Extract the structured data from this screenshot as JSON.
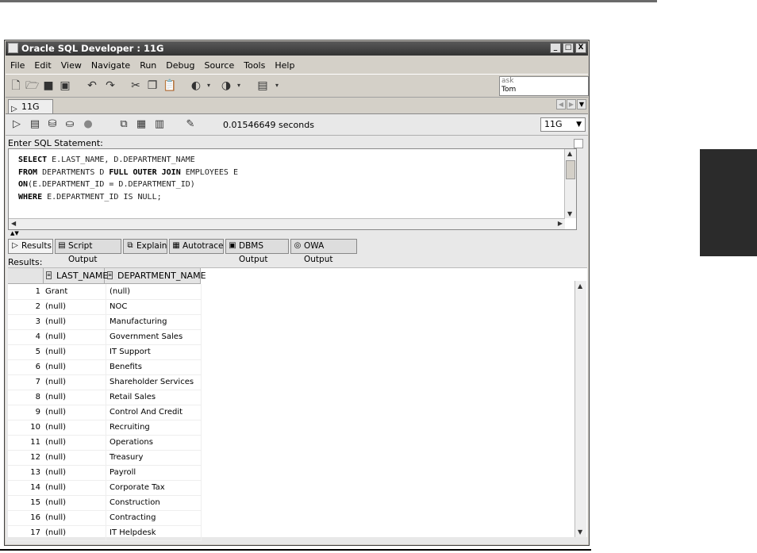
{
  "window": {
    "title": "Oracle SQL Developer : 11G",
    "buttons": [
      "_",
      "□",
      "X"
    ]
  },
  "menu": [
    "File",
    "Edit",
    "View",
    "Navigate",
    "Run",
    "Debug",
    "Source",
    "Tools",
    "Help"
  ],
  "toolbar": {
    "ask_label": "ask",
    "ask_user": "Tom"
  },
  "doc_tab": {
    "label": "11G"
  },
  "worksheet": {
    "timing": "0.01546649 seconds",
    "connection": "11G",
    "sql_label": "Enter SQL Statement:",
    "sql_lines": [
      {
        "kw1": "SELECT",
        "rest1": " E.LAST_NAME, D.DEPARTMENT_NAME"
      },
      {
        "kw1": "FROM",
        "rest1": " DEPARTMENTS D ",
        "kw2": "FULL OUTER JOIN",
        "rest2": " EMPLOYEES E"
      },
      {
        "kw1": "ON",
        "rest1": "(E.DEPARTMENT_ID = D.DEPARTMENT_ID)"
      },
      {
        "kw1": "WHERE",
        "rest1": " E.DEPARTMENT_ID IS NULL;"
      }
    ]
  },
  "result_tabs": [
    "Results",
    "Script Output",
    "Explain",
    "Autotrace",
    "DBMS Output",
    "OWA Output"
  ],
  "results_label": "Results:",
  "grid": {
    "columns": [
      "LAST_NAME",
      "DEPARTMENT_NAME"
    ],
    "rows": [
      {
        "n": "1",
        "last": "Grant",
        "dept": "(null)"
      },
      {
        "n": "2",
        "last": "(null)",
        "dept": "NOC"
      },
      {
        "n": "3",
        "last": "(null)",
        "dept": "Manufacturing"
      },
      {
        "n": "4",
        "last": "(null)",
        "dept": "Government Sales"
      },
      {
        "n": "5",
        "last": "(null)",
        "dept": "IT Support"
      },
      {
        "n": "6",
        "last": "(null)",
        "dept": "Benefits"
      },
      {
        "n": "7",
        "last": "(null)",
        "dept": "Shareholder Services"
      },
      {
        "n": "8",
        "last": "(null)",
        "dept": "Retail Sales"
      },
      {
        "n": "9",
        "last": "(null)",
        "dept": "Control And Credit"
      },
      {
        "n": "10",
        "last": "(null)",
        "dept": "Recruiting"
      },
      {
        "n": "11",
        "last": "(null)",
        "dept": "Operations"
      },
      {
        "n": "12",
        "last": "(null)",
        "dept": "Treasury"
      },
      {
        "n": "13",
        "last": "(null)",
        "dept": "Payroll"
      },
      {
        "n": "14",
        "last": "(null)",
        "dept": "Corporate Tax"
      },
      {
        "n": "15",
        "last": "(null)",
        "dept": "Construction"
      },
      {
        "n": "16",
        "last": "(null)",
        "dept": "Contracting"
      },
      {
        "n": "17",
        "last": "(null)",
        "dept": "IT Helpdesk"
      }
    ]
  }
}
